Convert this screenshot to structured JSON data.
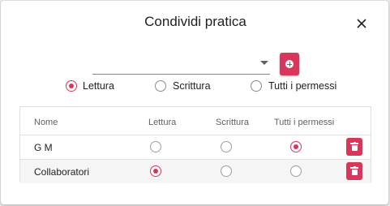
{
  "dialog": {
    "title": "Condividi pratica",
    "close_icon": "close-icon"
  },
  "user_select": {
    "value": "",
    "arrow_icon": "dropdown-arrow-icon"
  },
  "add_button": {
    "icon": "add-circle-icon",
    "color": "#d9365b"
  },
  "permission_options": [
    {
      "label": "Lettura",
      "selected": true
    },
    {
      "label": "Scrittura",
      "selected": false
    },
    {
      "label": "Tutti i permessi",
      "selected": false
    }
  ],
  "table": {
    "headers": [
      "Nome",
      "Lettura",
      "Scrittura",
      "Tutti i permessi",
      ""
    ],
    "rows": [
      {
        "name": "G M",
        "permission": "Tutti i permessi",
        "delete_icon": "trash-icon"
      },
      {
        "name": "Collaboratori",
        "permission": "Lettura",
        "delete_icon": "trash-icon"
      }
    ]
  },
  "accent_color": "#d9365b"
}
